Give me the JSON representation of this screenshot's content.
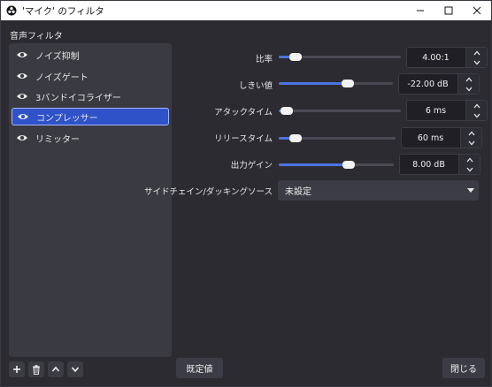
{
  "window": {
    "title": "'マイク' のフィルタ"
  },
  "filters_section": {
    "label": "音声フィルタ",
    "items": [
      {
        "label": "ノイズ抑制",
        "selected": false
      },
      {
        "label": "ノイズゲート",
        "selected": false
      },
      {
        "label": "3バンドイコライザー",
        "selected": false
      },
      {
        "label": "コンプレッサー",
        "selected": true
      },
      {
        "label": "リミッター",
        "selected": false
      }
    ]
  },
  "params": {
    "ratio": {
      "label": "比率",
      "value": "4.00:1",
      "level": 0.1
    },
    "threshold": {
      "label": "しきい値",
      "value": "-22.00 dB",
      "level": 0.62
    },
    "attack": {
      "label": "アタックタイム",
      "value": "6 ms",
      "level": 0.02
    },
    "release": {
      "label": "リリースタイム",
      "value": "60 ms",
      "level": 0.1
    },
    "output_gain": {
      "label": "出力ゲイン",
      "value": "8.00 dB",
      "level": 0.62
    },
    "sidechain": {
      "label": "サイドチェイン/ダッキングソース",
      "value": "未設定"
    }
  },
  "buttons": {
    "defaults": "既定値",
    "close": "閉じる"
  },
  "colors": {
    "accent": "#4a74e0",
    "selection": "#2f52c8"
  }
}
